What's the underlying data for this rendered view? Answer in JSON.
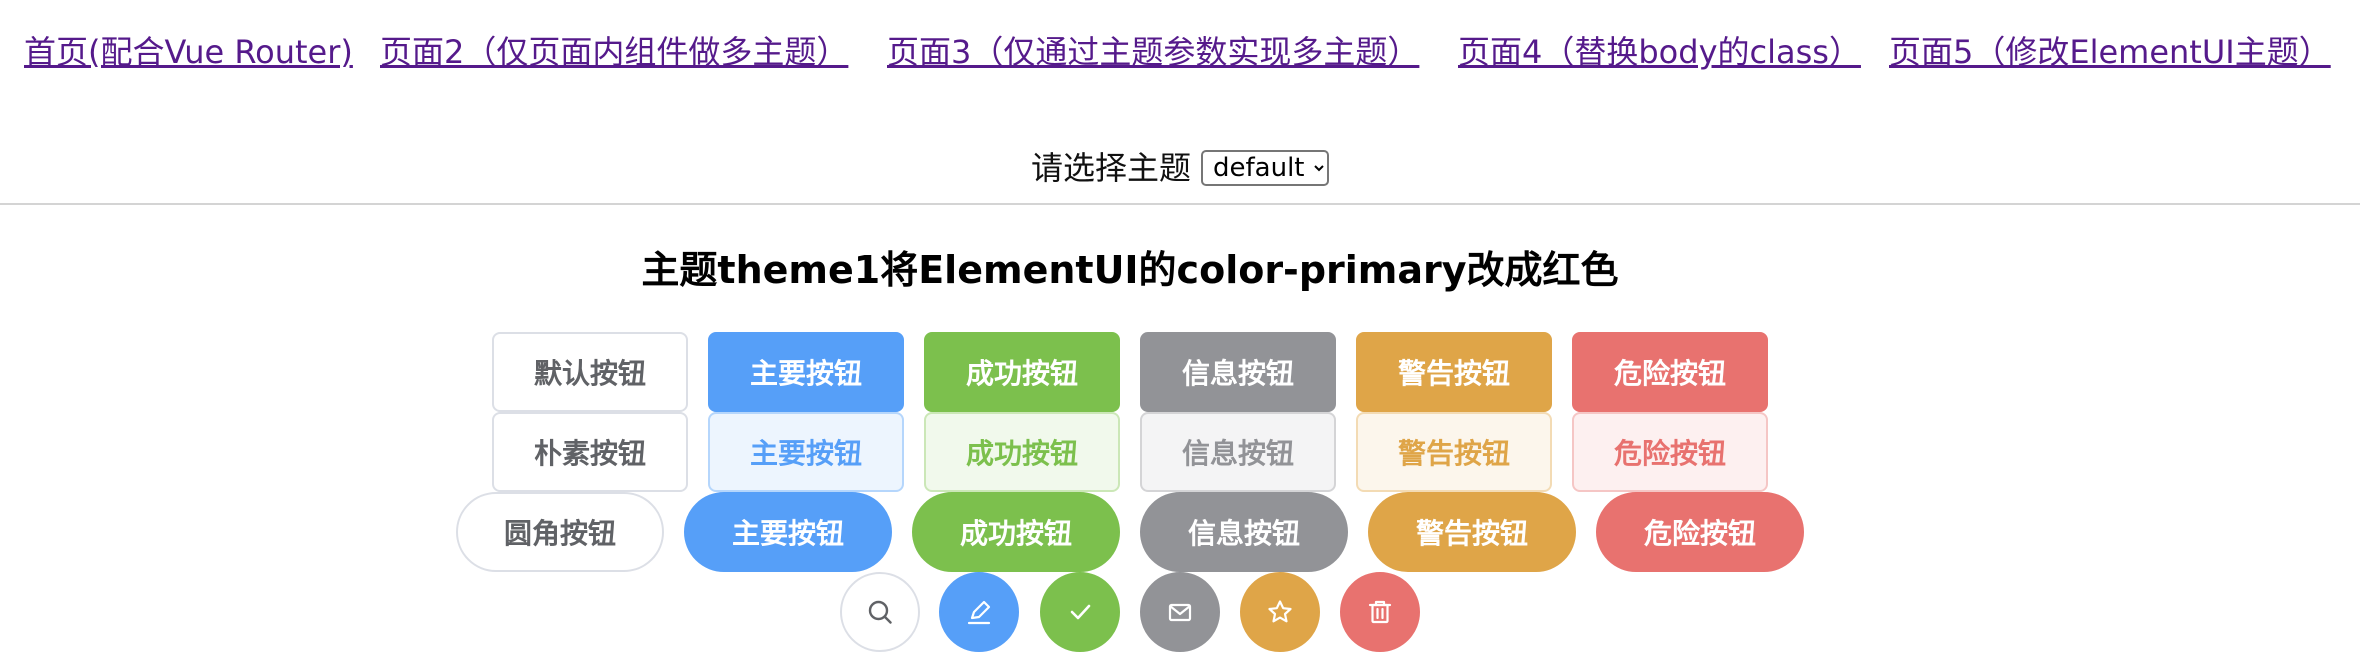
{
  "nav": {
    "links": [
      "首页(配合Vue Router)",
      "页面2（仅页面内组件做多主题）",
      "页面3（仅通过主题参数实现多主题）",
      "页面4（替换body的class）",
      "页面5（修改ElementUI主题）"
    ]
  },
  "theme_select": {
    "label": "请选择主题",
    "value": "default"
  },
  "heading": "主题theme1将ElementUI的color-primary改成红色",
  "buttons": {
    "default_row": [
      "默认按钮",
      "主要按钮",
      "成功按钮",
      "信息按钮",
      "警告按钮",
      "危险按钮"
    ],
    "plain_row": [
      "朴素按钮",
      "主要按钮",
      "成功按钮",
      "信息按钮",
      "警告按钮",
      "危险按钮"
    ],
    "round_row": [
      "圆角按钮",
      "主要按钮",
      "成功按钮",
      "信息按钮",
      "警告按钮",
      "危险按钮"
    ],
    "circle_row_icons": [
      "search-icon",
      "edit-icon",
      "check-icon",
      "message-icon",
      "star-icon",
      "delete-icon"
    ]
  },
  "colors": {
    "primary": "#569ff8",
    "success": "#7cc04d",
    "info": "#929397",
    "warning": "#dfa548",
    "danger": "#e8726f",
    "link": "#551a8b"
  }
}
